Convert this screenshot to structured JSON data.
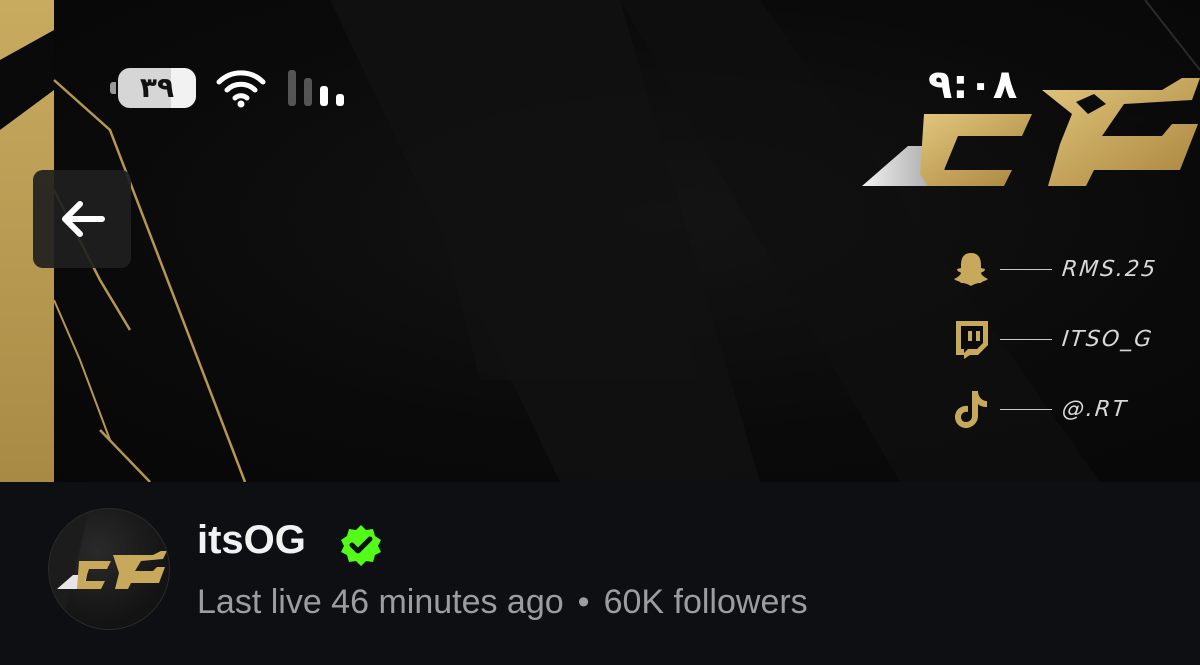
{
  "status_bar": {
    "battery_level": "٣٩",
    "time": "٩:٠٨"
  },
  "nav": {
    "back_icon": "arrow-left-icon"
  },
  "socials": [
    {
      "icon": "snapchat-icon",
      "handle": "RMS.25"
    },
    {
      "icon": "twitch-icon",
      "handle": "ITSO_G"
    },
    {
      "icon": "tiktok-icon",
      "handle": "@.RT"
    }
  ],
  "channel": {
    "name": "itsOG",
    "verified": true,
    "last_live": "Last live 46 minutes ago",
    "separator": "•",
    "followers": "60K followers"
  },
  "colors": {
    "gold": "#c8a95b",
    "verified_green": "#53fc18",
    "background": "#0e0f12"
  }
}
